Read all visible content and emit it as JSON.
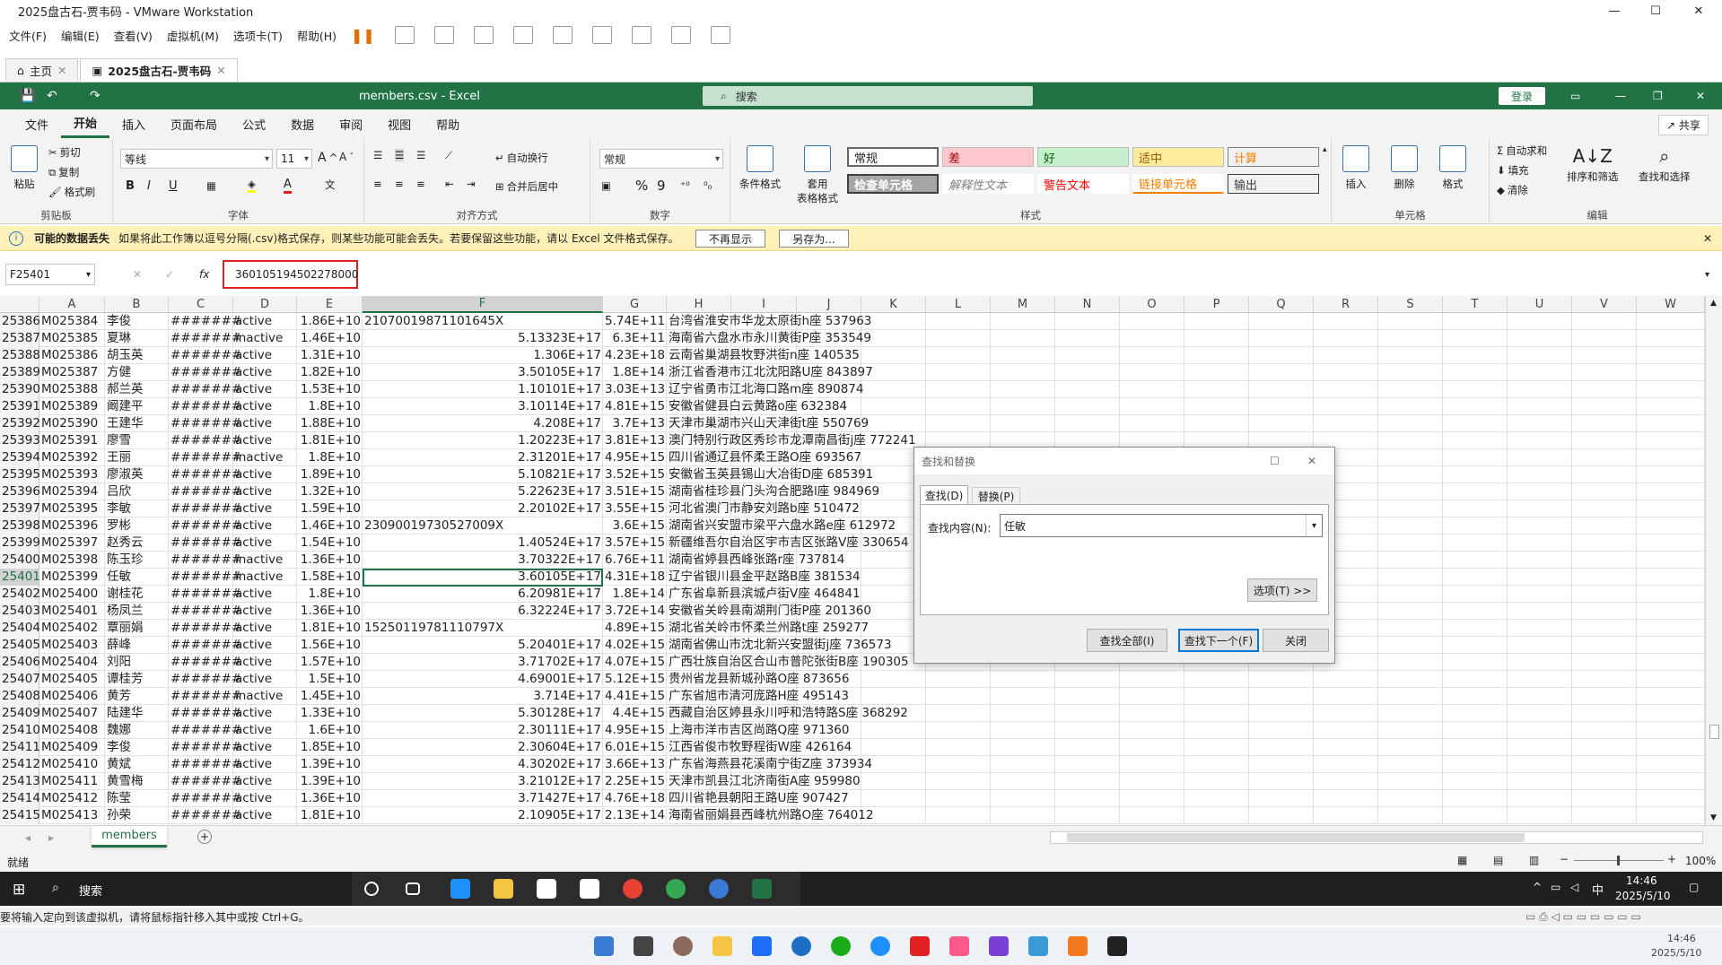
{
  "vmware": {
    "title": "2025盘古石-贾韦码 - VMware Workstation",
    "menu": [
      "文件(F)",
      "编辑(E)",
      "查看(V)",
      "虚拟机(M)",
      "选项卡(T)",
      "帮助(H)"
    ],
    "tabs": [
      {
        "label": "主页"
      },
      {
        "label": "2025盘古石-贾韦码"
      }
    ],
    "status_text": "要将输入定向到该虚拟机，请将鼠标指针移入其中或按 Ctrl+G。"
  },
  "excel": {
    "title": "members.csv - Excel",
    "search_placeholder": "搜索",
    "login": "登录",
    "share": "共享",
    "ribbon_tabs": [
      "文件",
      "开始",
      "插入",
      "页面布局",
      "公式",
      "数据",
      "审阅",
      "视图",
      "帮助"
    ],
    "clipboard": {
      "paste": "粘贴",
      "cut": "剪切",
      "copy": "复制",
      "format_painter": "格式刷",
      "label": "剪贴板"
    },
    "font": {
      "name": "等线",
      "size": "11",
      "label": "字体"
    },
    "align": {
      "wrap": "自动换行",
      "merge": "合并后居中",
      "label": "对齐方式"
    },
    "number": {
      "format": "常规",
      "label": "数字"
    },
    "styles": {
      "cond": "条件格式",
      "table": "套用\n表格格式",
      "cells": [
        "常规",
        "差",
        "好",
        "适中",
        "计算",
        "检查单元格",
        "解释性文本",
        "警告文本",
        "链接单元格",
        "输出"
      ],
      "label": "样式"
    },
    "cells_group": {
      "insert": "插入",
      "delete": "删除",
      "format": "格式",
      "label": "单元格"
    },
    "editing": {
      "autosum": "自动求和",
      "fill": "填充",
      "clear": "清除",
      "sort": "排序和筛选",
      "find": "查找和选择",
      "label": "编辑"
    },
    "message": {
      "title": "可能的数据丢失",
      "text": "如果将此工作簿以逗号分隔(.csv)格式保存，则某些功能可能会丢失。若要保留这些功能，请以 Excel 文件格式保存。",
      "btn1": "不再显示",
      "btn2": "另存为..."
    },
    "namebox": "F25401",
    "formula_value": "360105194502278000",
    "columns": [
      "A",
      "B",
      "C",
      "D",
      "E",
      "F",
      "G",
      "H",
      "I",
      "J",
      "K",
      "L",
      "M",
      "N",
      "O",
      "P",
      "Q",
      "R",
      "S",
      "T",
      "U",
      "V",
      "W"
    ],
    "rows": [
      [
        "25386",
        "M025384",
        "李俊",
        "#######",
        "active",
        "1.86E+10",
        "21070019871101645X",
        "5.74E+11",
        "台湾省淮安市华龙太原街h座 537963"
      ],
      [
        "25387",
        "M025385",
        "夏琳",
        "#######",
        "inactive",
        "1.46E+10",
        "5.13323E+17",
        "6.3E+11",
        "海南省六盘水市永川黄街P座 353549"
      ],
      [
        "25388",
        "M025386",
        "胡玉英",
        "#######",
        "active",
        "1.31E+10",
        "1.306E+17",
        "4.23E+18",
        "云南省巢湖县牧野洪街n座 140535"
      ],
      [
        "25389",
        "M025387",
        "方健",
        "#######",
        "active",
        "1.82E+10",
        "3.50105E+17",
        "1.8E+14",
        "浙江省香港市江北沈阳路U座 843897"
      ],
      [
        "25390",
        "M025388",
        "郝兰英",
        "#######",
        "active",
        "1.53E+10",
        "1.10101E+17",
        "3.03E+13",
        "辽宁省勇市江北海口路m座 890874"
      ],
      [
        "25391",
        "M025389",
        "阚建平",
        "#######",
        "active",
        "1.8E+10",
        "3.10114E+17",
        "4.81E+15",
        "安徽省健县白云黄路o座 632384"
      ],
      [
        "25392",
        "M025390",
        "王建华",
        "#######",
        "active",
        "1.88E+10",
        "4.208E+17",
        "3.7E+13",
        "天津市巢湖市兴山天津街t座 550769"
      ],
      [
        "25393",
        "M025391",
        "廖雪",
        "#######",
        "active",
        "1.81E+10",
        "1.20223E+17",
        "3.81E+13",
        "澳门特别行政区秀珍市龙潭南昌街j座 772241"
      ],
      [
        "25394",
        "M025392",
        "王丽",
        "#######",
        "inactive",
        "1.8E+10",
        "2.31201E+17",
        "4.95E+15",
        "四川省通辽县怀柔王路O座 693567"
      ],
      [
        "25395",
        "M025393",
        "廖淑英",
        "#######",
        "active",
        "1.89E+10",
        "5.10821E+17",
        "3.52E+15",
        "安徽省玉英县锡山大冶街D座 685391"
      ],
      [
        "25396",
        "M025394",
        "吕欣",
        "#######",
        "active",
        "1.32E+10",
        "5.22623E+17",
        "3.51E+15",
        "湖南省桂珍县门头沟合肥路l座 984969"
      ],
      [
        "25397",
        "M025395",
        "李敏",
        "#######",
        "active",
        "1.59E+10",
        "2.20102E+17",
        "3.55E+15",
        "河北省澳门市静安刘路b座 510472"
      ],
      [
        "25398",
        "M025396",
        "罗彬",
        "#######",
        "active",
        "1.46E+10",
        "23090019730527009X",
        "3.6E+15",
        "湖南省兴安盟市梁平六盘水路e座 612972"
      ],
      [
        "25399",
        "M025397",
        "赵秀云",
        "#######",
        "active",
        "1.54E+10",
        "1.40524E+17",
        "3.57E+15",
        "新疆维吾尔自治区宇市吉区张路V座 330654"
      ],
      [
        "25400",
        "M025398",
        "陈玉珍",
        "#######",
        "inactive",
        "1.36E+10",
        "3.70322E+17",
        "6.76E+11",
        "湖南省婷县西峰张路r座 737814"
      ],
      [
        "25401",
        "M025399",
        "任敏",
        "#######",
        "inactive",
        "1.58E+10",
        "3.60105E+17",
        "4.31E+18",
        "辽宁省银川县金平赵路B座 381534"
      ],
      [
        "25402",
        "M025400",
        "谢桂花",
        "#######",
        "active",
        "1.8E+10",
        "6.20981E+17",
        "1.8E+14",
        "广东省阜新县滨城卢街V座 464841"
      ],
      [
        "25403",
        "M025401",
        "杨凤兰",
        "#######",
        "active",
        "1.36E+10",
        "6.32224E+17",
        "3.72E+14",
        "安徽省关岭县南湖荆门街P座 201360"
      ],
      [
        "25404",
        "M025402",
        "覃丽娟",
        "#######",
        "active",
        "1.81E+10",
        "15250119781110797X",
        "4.89E+15",
        "湖北省关岭市怀柔兰州路t座 259277"
      ],
      [
        "25405",
        "M025403",
        "薛峰",
        "#######",
        "active",
        "1.56E+10",
        "5.20401E+17",
        "4.02E+15",
        "湖南省佛山市沈北新兴安盟街j座 736573"
      ],
      [
        "25406",
        "M025404",
        "刘阳",
        "#######",
        "active",
        "1.57E+10",
        "3.71702E+17",
        "4.07E+15",
        "广西壮族自治区合山市普陀张街B座 190305"
      ],
      [
        "25407",
        "M025405",
        "谭桂芳",
        "#######",
        "active",
        "1.5E+10",
        "4.69001E+17",
        "5.12E+15",
        "贵州省龙县新城孙路O座 873656"
      ],
      [
        "25408",
        "M025406",
        "黄芳",
        "#######",
        "inactive",
        "1.45E+10",
        "3.714E+17",
        "4.41E+15",
        "广东省旭市清河庞路H座 495143"
      ],
      [
        "25409",
        "M025407",
        "陆建华",
        "#######",
        "active",
        "1.33E+10",
        "5.30128E+17",
        "4.4E+15",
        "西藏自治区婷县永川呼和浩特路S座 368292"
      ],
      [
        "25410",
        "M025408",
        "魏娜",
        "#######",
        "active",
        "1.6E+10",
        "2.30111E+17",
        "4.95E+15",
        "上海市洋市吉区尚路Q座 971360"
      ],
      [
        "25411",
        "M025409",
        "李俊",
        "#######",
        "active",
        "1.85E+10",
        "2.30604E+17",
        "6.01E+15",
        "江西省俊市牧野程街W座 426164"
      ],
      [
        "25412",
        "M025410",
        "黄斌",
        "#######",
        "active",
        "1.39E+10",
        "4.30202E+17",
        "3.66E+13",
        "广东省海燕县花溪南宁街Z座 373934"
      ],
      [
        "25413",
        "M025411",
        "黄雪梅",
        "#######",
        "active",
        "1.39E+10",
        "3.21012E+17",
        "2.25E+15",
        "天津市凯县江北济南街A座 959980"
      ],
      [
        "25414",
        "M025412",
        "陈莹",
        "#######",
        "active",
        "1.36E+10",
        "3.71427E+17",
        "4.76E+18",
        "四川省艳县朝阳王路U座 907427"
      ],
      [
        "25415",
        "M025413",
        "孙荣",
        "#######",
        "active",
        "1.81E+10",
        "2.10905E+17",
        "2.13E+14",
        "海南省丽娟县西峰杭州路O座 764012"
      ]
    ],
    "sheet_tab": "members",
    "status": "就绪",
    "zoom": "100%"
  },
  "dialog": {
    "title": "查找和替换",
    "tab_find": "查找(D)",
    "tab_replace": "替换(P)",
    "find_label": "查找内容(N):",
    "find_value": "任敏",
    "options": "选项(T) >>",
    "find_all": "查找全部(I)",
    "find_next": "查找下一个(F)",
    "close": "关闭"
  },
  "taskbar": {
    "search": "搜索",
    "time": "14:46",
    "date": "2025/5/10",
    "ime": "中"
  },
  "host": {
    "time": "14:46",
    "date": "2025/5/10"
  },
  "colors": {
    "excel_green": "#217346",
    "message_bg": "#fff1b8",
    "highlight_red": "#e02020"
  }
}
